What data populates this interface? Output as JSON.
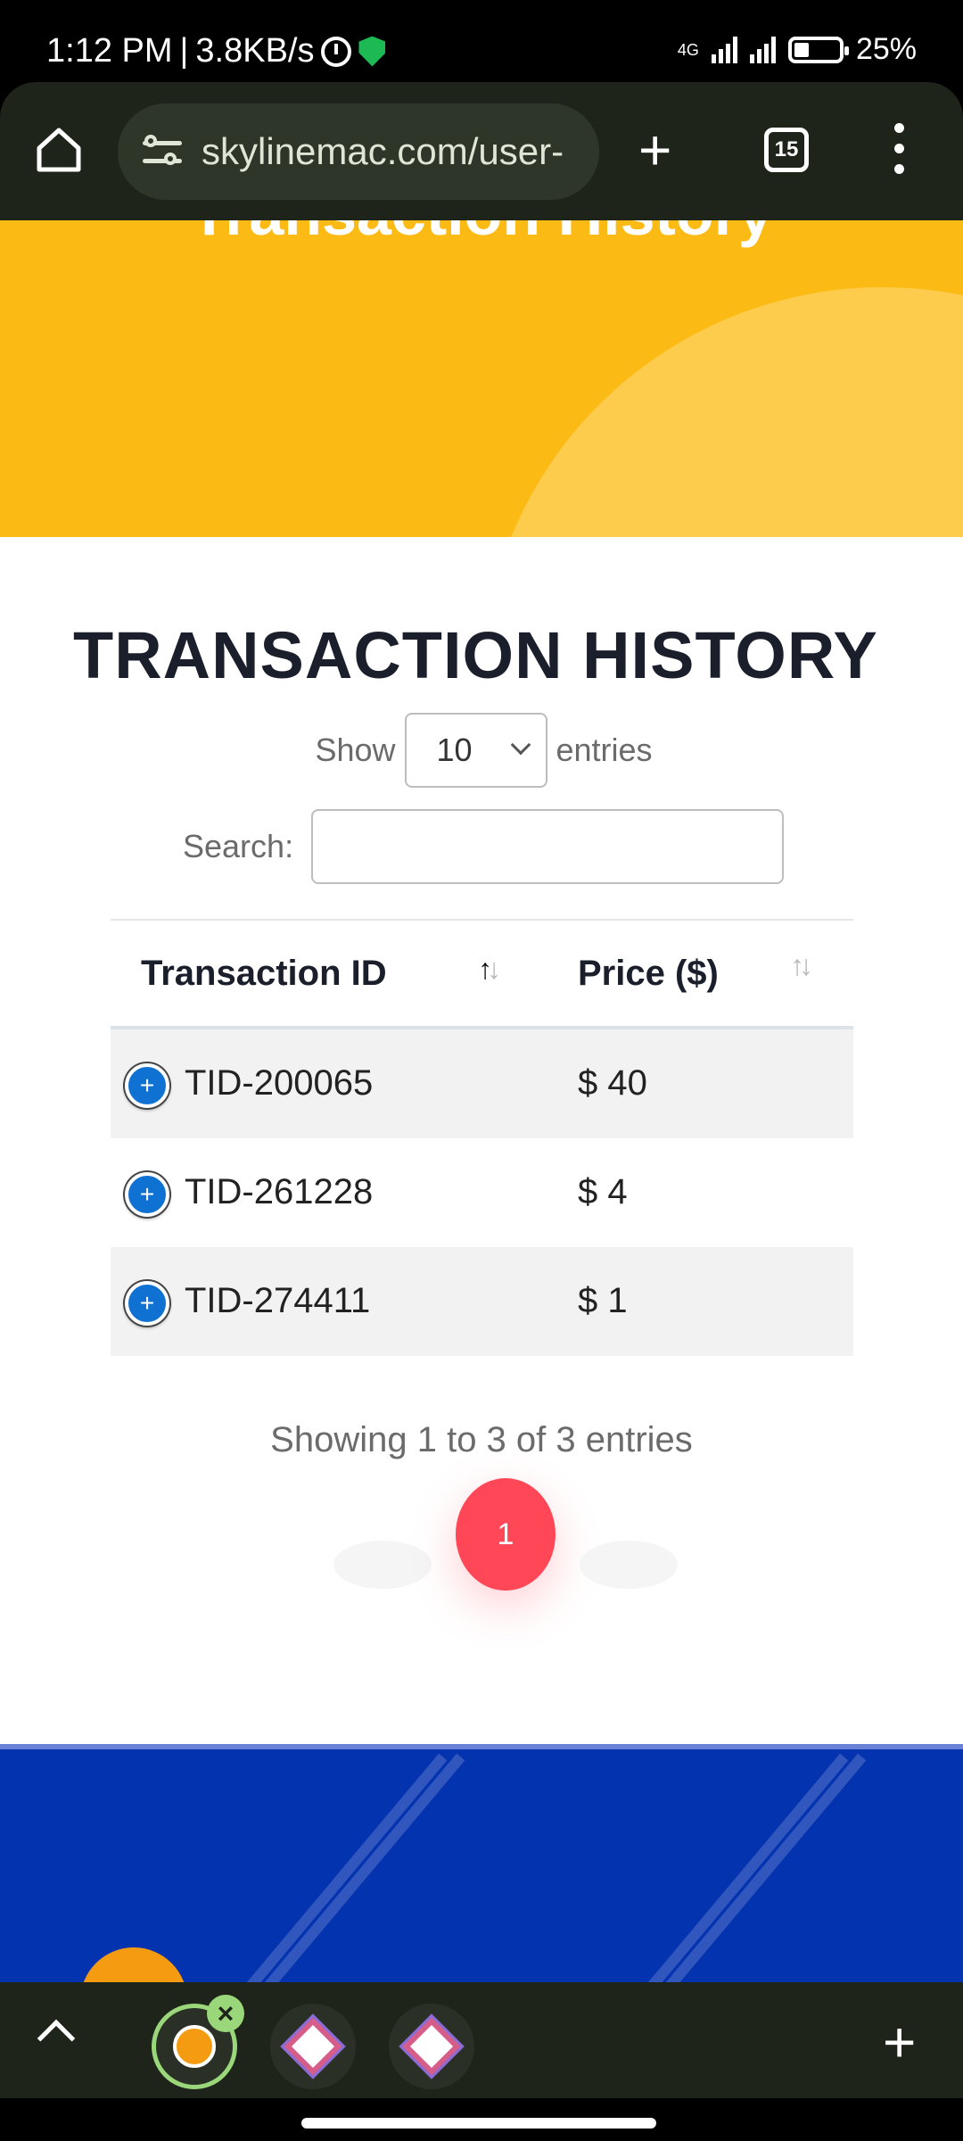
{
  "status_bar": {
    "time": "1:12 PM",
    "speed": "3.8KB/s",
    "network": "4G",
    "battery": "25%"
  },
  "browser": {
    "url": "skylinemac.com/user-",
    "tab_count": "15"
  },
  "hero": {
    "title": "Transaction History"
  },
  "section": {
    "title": "TRANSACTION HISTORY"
  },
  "length_control": {
    "prefix": "Show",
    "value": "10",
    "suffix": "entries"
  },
  "search": {
    "label": "Search:",
    "value": ""
  },
  "table": {
    "columns": [
      "Transaction ID",
      "Price ($)"
    ],
    "rows": [
      {
        "id": "TID-200065",
        "price": "$ 40"
      },
      {
        "id": "TID-261228",
        "price": "$ 4"
      },
      {
        "id": "TID-274411",
        "price": "$ 1"
      }
    ],
    "expand_symbol": "+"
  },
  "info": "Showing 1 to 3 of 3 entries",
  "pagination": {
    "current_page": "1"
  },
  "colors": {
    "hero": "#fcbb14",
    "accent": "#ff4757",
    "expand_button": "#0f72d3",
    "footer": "#0433b0"
  }
}
